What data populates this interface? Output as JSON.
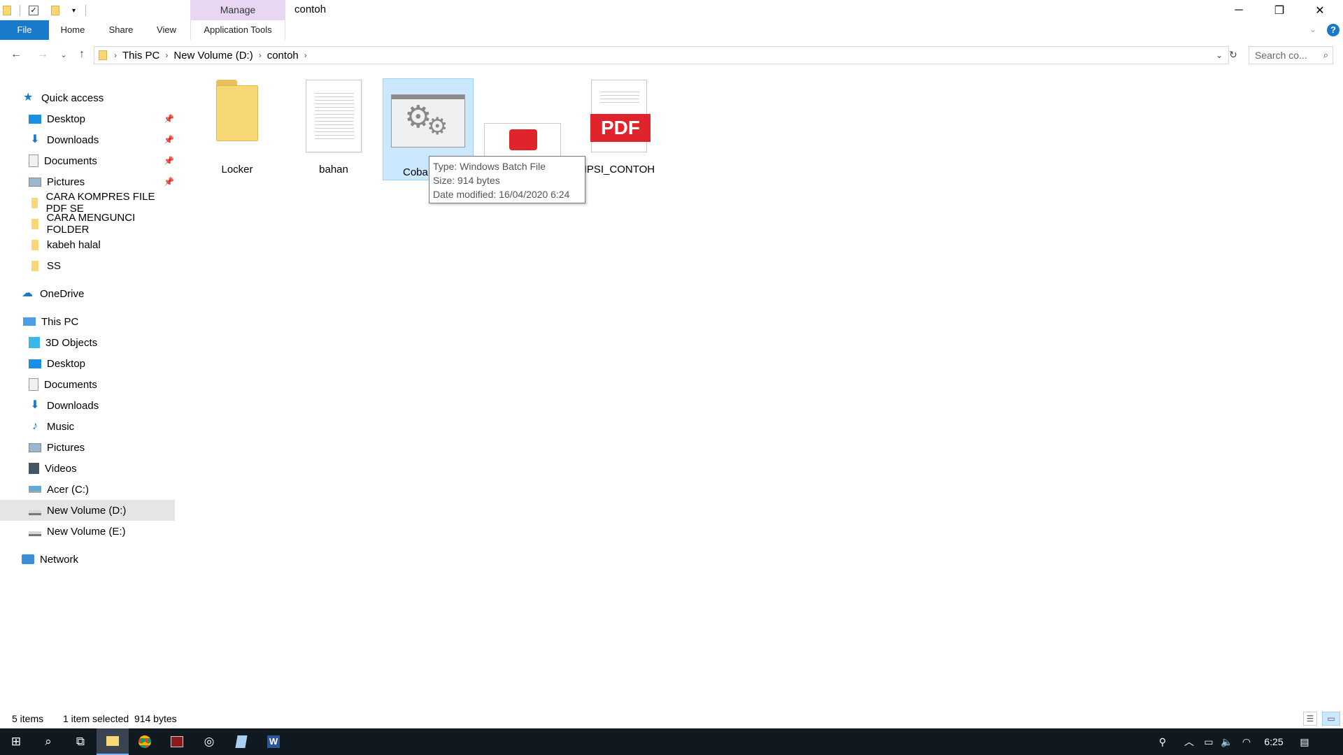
{
  "window": {
    "title": "contoh",
    "manage_tab": "Manage",
    "minimize": "─",
    "restore": "❐",
    "close": "✕"
  },
  "ribbon": {
    "tabs": [
      {
        "label": "File"
      },
      {
        "label": "Home"
      },
      {
        "label": "Share"
      },
      {
        "label": "View"
      },
      {
        "label": "Application Tools"
      }
    ],
    "help": "?"
  },
  "address": {
    "crumbs": [
      "This PC",
      "New Volume (D:)",
      "contoh"
    ],
    "search_placeholder": "Search co..."
  },
  "sidebar": {
    "quick_access": "Quick access",
    "quick_items": [
      {
        "label": "Desktop",
        "pinned": true
      },
      {
        "label": "Downloads",
        "pinned": true
      },
      {
        "label": "Documents",
        "pinned": true
      },
      {
        "label": "Pictures",
        "pinned": true
      },
      {
        "label": "CARA KOMPRES FILE PDF SE"
      },
      {
        "label": "CARA MENGUNCI FOLDER"
      },
      {
        "label": "kabeh halal"
      },
      {
        "label": "SS"
      }
    ],
    "onedrive": "OneDrive",
    "this_pc": "This PC",
    "pc_items": [
      {
        "label": "3D Objects"
      },
      {
        "label": "Desktop"
      },
      {
        "label": "Documents"
      },
      {
        "label": "Downloads"
      },
      {
        "label": "Music"
      },
      {
        "label": "Pictures"
      },
      {
        "label": "Videos"
      },
      {
        "label": "Acer (C:)"
      },
      {
        "label": "New Volume (D:)"
      },
      {
        "label": "New Volume (E:)"
      }
    ],
    "network": "Network"
  },
  "files": [
    {
      "label": "Locker",
      "type": "folder"
    },
    {
      "label": "bahan",
      "type": "text"
    },
    {
      "label": "Coba",
      "type": "batch"
    },
    {
      "label": "",
      "type": "image"
    },
    {
      "label": "KRIPSI_CONTOH",
      "type": "pdf"
    }
  ],
  "pdf_badge": "PDF",
  "tooltip": {
    "type": "Type: Windows Batch File",
    "size": "Size: 914 bytes",
    "modified": "Date modified: 16/04/2020 6:24"
  },
  "status": {
    "count": "5 items",
    "selection": "1 item selected  914 bytes"
  },
  "taskbar": {
    "time": "6:25"
  },
  "colors": {
    "accent": "#1979ca",
    "selected_bg": "#cce8ff",
    "manage_tab": "#e8d6f2",
    "folder": "#f8d775",
    "pdf_red": "#e0242b",
    "taskbar": "#101820"
  }
}
